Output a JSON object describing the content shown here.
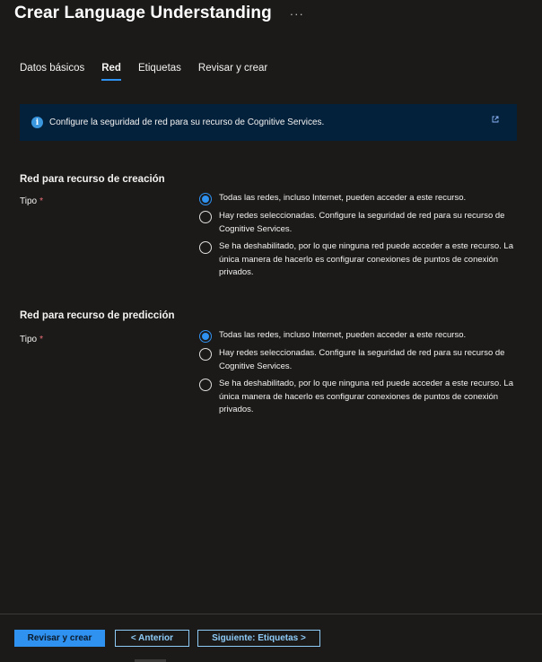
{
  "header": {
    "title": "Crear Language Understanding",
    "more_label": "···"
  },
  "tabs": [
    {
      "label": "Datos básicos",
      "active": false
    },
    {
      "label": "Red",
      "active": true
    },
    {
      "label": "Etiquetas",
      "active": false
    },
    {
      "label": "Revisar y crear",
      "active": false
    }
  ],
  "info_banner": {
    "text": "Configure la seguridad de red para su recurso de Cognitive Services.",
    "icon": "info-icon",
    "link_icon": "external-link-icon"
  },
  "sections": [
    {
      "title": "Red para recurso de creación",
      "field_label": "Tipo",
      "required_mark": "*",
      "options": [
        {
          "label": "Todas las redes, incluso Internet, pueden acceder a este recurso.",
          "checked": true
        },
        {
          "label": "Hay redes seleccionadas. Configure la seguridad de red para su recurso de Cognitive Services.",
          "checked": false
        },
        {
          "label": "Se ha deshabilitado, por lo que ninguna red puede acceder a este recurso. La única manera de hacerlo es configurar conexiones de puntos de conexión privados.",
          "checked": false
        }
      ]
    },
    {
      "title": "Red para recurso de predicción",
      "field_label": "Tipo",
      "required_mark": "*",
      "options": [
        {
          "label": "Todas las redes, incluso Internet, pueden acceder a este recurso.",
          "checked": true
        },
        {
          "label": "Hay redes seleccionadas. Configure la seguridad de red para su recurso de Cognitive Services.",
          "checked": false
        },
        {
          "label": "Se ha deshabilitado, por lo que ninguna red puede acceder a este recurso. La única manera de hacerlo es configurar conexiones de puntos de conexión privados.",
          "checked": false
        }
      ]
    }
  ],
  "footer": {
    "review_label": "Revisar y crear",
    "prev_label": "< Anterior",
    "next_label": "Siguiente: Etiquetas >"
  },
  "colors": {
    "background": "#1b1a19",
    "accent": "#2f91f0",
    "info_background": "#04213c",
    "required": "#f1707b"
  }
}
